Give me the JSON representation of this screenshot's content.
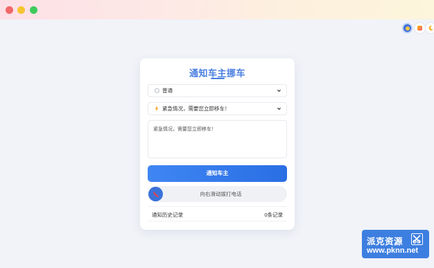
{
  "window": {
    "controls": [
      "close",
      "minimize",
      "maximize"
    ]
  },
  "theme_toggles": [
    {
      "name": "light-mode",
      "icon": "sun-icon"
    },
    {
      "name": "auto-mode",
      "icon": "auto-theme-icon"
    },
    {
      "name": "dark-mode",
      "icon": "moon-icon"
    }
  ],
  "card": {
    "title": "通知车主挪车",
    "level_select": {
      "value": "普通",
      "icon": "radio-circle-icon"
    },
    "message_select": {
      "value": "紧急情况，需要您立即移车！",
      "icon": "lightning-icon"
    },
    "message_text": "紧急情况，需要您立即移车！",
    "notify_button": "通知车主",
    "call_slider": {
      "label": "向右滑动拨打电话",
      "icon": "phone-off-icon"
    },
    "history": {
      "label": "通知历史记录",
      "count": "0条记录"
    }
  },
  "watermark": {
    "line1": "派克资源",
    "line2": "www.pknn.net",
    "icon": "logo-mark-icon"
  },
  "colors": {
    "accent": "#3a72d9",
    "title": "#4a7fe0",
    "background": "#f1f3f8"
  }
}
